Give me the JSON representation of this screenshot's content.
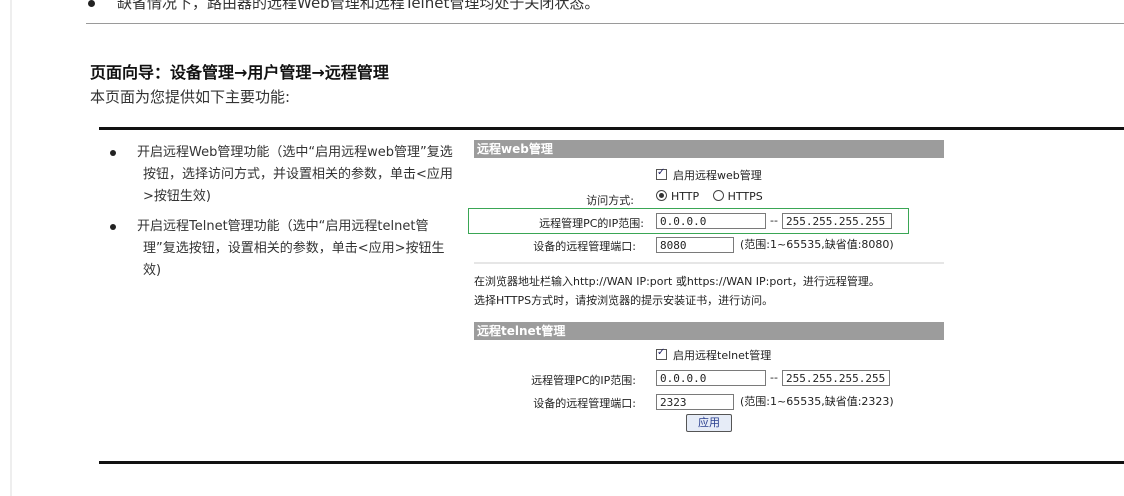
{
  "top_bullet": "缺省情况下，路由器的远程Web管理和远程Telnet管理均处于关闭状态。",
  "nav_title": "页面向导：设备管理→用户管理→远程管理",
  "intro": "本页面为您提供如下主要功能:",
  "features": [
    "开启远程Web管理功能（选中“启用远程web管理”复选按钮，选择访问方式，并设置相关的参数，单击<应用>按钮生效)",
    "开启远程Telnet管理功能（选中“启用远程telnet管理”复选按钮，设置相关的参数，单击<应用>按钮生效)"
  ],
  "web_section": {
    "title": "远程web管理",
    "enable_label": "启用远程web管理",
    "enable_checked": true,
    "access_label": "访问方式:",
    "access_options": [
      "HTTP",
      "HTTPS"
    ],
    "access_selected": "HTTP",
    "ip_range_label": "远程管理PC的IP范围:",
    "ip_start": "0.0.0.0",
    "ip_separator": "--",
    "ip_end": "255.255.255.255",
    "port_label": "设备的远程管理端口:",
    "port": "8080",
    "port_hint": "(范围:1~65535,缺省值:8080)",
    "note_line1": "在浏览器地址栏输入http://WAN IP:port 或https://WAN IP:port，进行远程管理。",
    "note_line2": "选择HTTPS方式时，请按浏览器的提示安装证书，进行访问。"
  },
  "telnet_section": {
    "title": "远程telnet管理",
    "enable_label": "启用远程telnet管理",
    "enable_checked": true,
    "ip_range_label": "远程管理PC的IP范围:",
    "ip_start": "0.0.0.0",
    "ip_separator": "--",
    "ip_end": "255.255.255.255",
    "port_label": "设备的远程管理端口:",
    "port": "2323",
    "port_hint": "(范围:1~65535,缺省值:2323)",
    "apply_label": "应用"
  },
  "colors": {
    "section_header_bg": "#9c9c9c",
    "highlight_box": "#3aa655",
    "frame_rule": "#111111"
  }
}
